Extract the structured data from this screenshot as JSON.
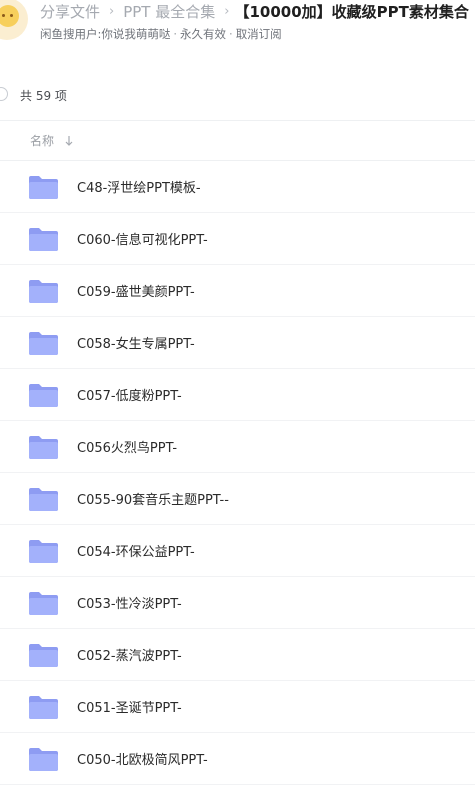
{
  "breadcrumb": {
    "root": "分享文件",
    "parent": "PPT 最全合集",
    "current": "【10000加】收藏级PPT素材集合"
  },
  "share_info": {
    "user": "闲鱼搜用户:你说我萌萌哒",
    "validity": "永久有效",
    "action": "取消订阅"
  },
  "list": {
    "count_label": "共 59 项",
    "sort_label": "名称"
  },
  "files": [
    {
      "name": "C48-浮世绘PPT模板-"
    },
    {
      "name": "C060-信息可视化PPT-"
    },
    {
      "name": "C059-盛世美颜PPT-"
    },
    {
      "name": "C058-女生专属PPT-"
    },
    {
      "name": "C057-低度粉PPT-"
    },
    {
      "name": "C056火烈鸟PPT-"
    },
    {
      "name": "C055-90套音乐主题PPT--"
    },
    {
      "name": "C054-环保公益PPT-"
    },
    {
      "name": "C053-性冷淡PPT-"
    },
    {
      "name": "C052-蒸汽波PPT-"
    },
    {
      "name": "C051-圣诞节PPT-"
    },
    {
      "name": "C050-北欧极简风PPT-"
    }
  ],
  "colors": {
    "folder_back": "#8e9cf2",
    "folder_front": "#a3b1fb",
    "muted_text": "#a5a9b0",
    "primary_text": "#1f1f1f"
  },
  "icons": {
    "folder": "folder-icon",
    "sort": "arrow-down-icon",
    "avatar": "avatar-icon"
  }
}
